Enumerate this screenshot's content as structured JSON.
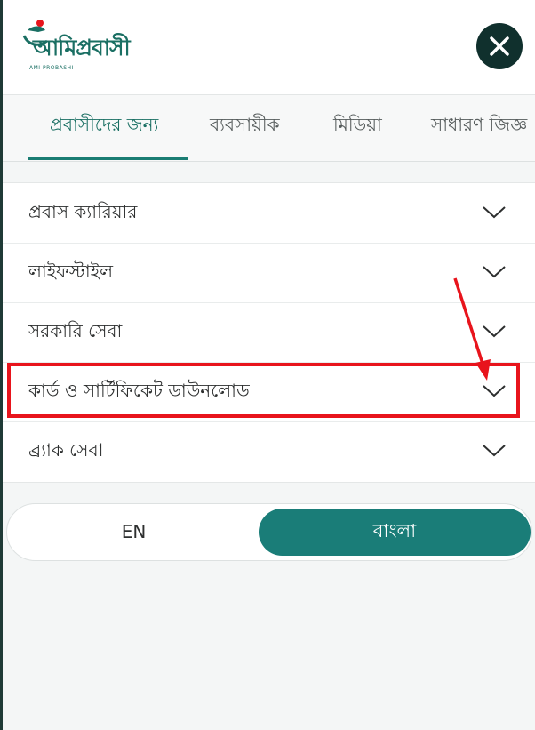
{
  "header": {
    "logo_text": "আমিপ্রবাসী",
    "logo_subtext": "AMI PROBASHI",
    "close_symbol": "✕"
  },
  "tabs": [
    {
      "label": "প্রবাসীদের জন্য",
      "active": true
    },
    {
      "label": "ব্যবসায়ীক",
      "active": false
    },
    {
      "label": "মিডিয়া",
      "active": false
    },
    {
      "label": "সাধারণ জিজ্ঞ",
      "active": false
    }
  ],
  "menu": {
    "items": [
      {
        "label": "প্রবাস ক্যারিয়ার",
        "icon": "chevron-down-icon"
      },
      {
        "label": "লাইফস্টাইল",
        "icon": "chevron-down-icon"
      },
      {
        "label": "সরকারি সেবা",
        "icon": "chevron-down-icon"
      },
      {
        "label": "কার্ড ও সার্টিফিকেট ডাউনলোড",
        "icon": "chevron-down-icon",
        "highlighted": true
      },
      {
        "label": "ব্র্যাক সেবা",
        "icon": "chevron-down-icon"
      }
    ]
  },
  "language": {
    "en_label": "EN",
    "bn_label": "বাংলা",
    "selected": "bn"
  },
  "colors": {
    "accent": "#1a7d78",
    "close_bg": "#10302d",
    "highlight": "#e8141c"
  }
}
